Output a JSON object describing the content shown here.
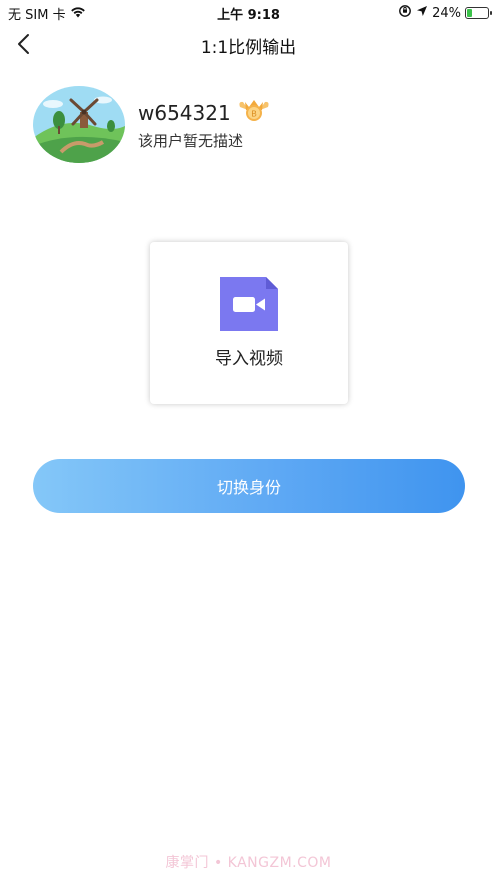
{
  "status_bar": {
    "carrier": "无 SIM 卡",
    "time": "上午 9:18",
    "battery_percent": "24%",
    "battery_level": 0.24,
    "battery_color": "#3bc24a"
  },
  "nav": {
    "title": "1:1比例输出",
    "back_icon": "chevron-left-icon"
  },
  "profile": {
    "username": "w654321",
    "badge_icon": "crown-badge-icon",
    "badge_letter": "B",
    "description": "该用户暂无描述"
  },
  "import_card": {
    "icon": "video-camera-icon",
    "icon_color": "#7b78f0",
    "label": "导入视频"
  },
  "switch_button": {
    "label": "切换身份",
    "gradient": [
      "#84c7f8",
      "#3f94ef"
    ]
  },
  "watermark": "康掌门 • KANGZM.COM"
}
